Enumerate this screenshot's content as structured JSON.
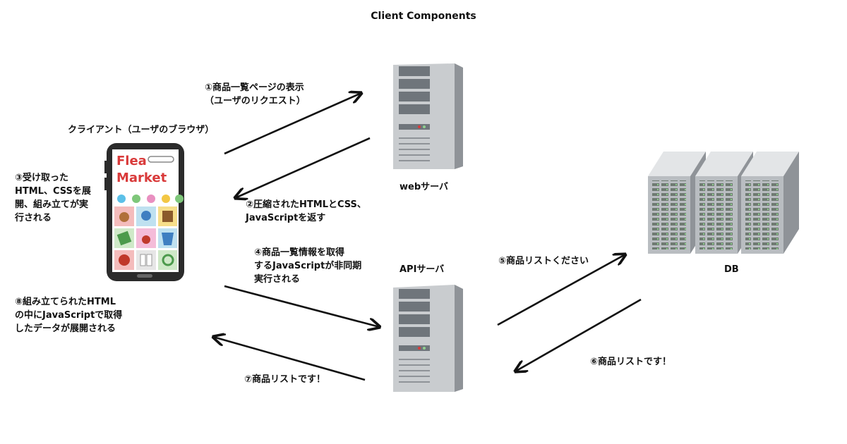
{
  "title": "Client Components",
  "client": {
    "label": "クライアント（ユーザのブラウザ）",
    "phone_logo_line1": "Flea",
    "phone_logo_line2": "Market"
  },
  "nodes": {
    "web_server": "webサーバ",
    "api_server": "APIサーバ",
    "db": "DB"
  },
  "steps": {
    "s1": "①商品一覧ページの表示\n（ユーザのリクエスト）",
    "s2": "②圧縮されたHTMLとCSS、\nJavaScriptを返す",
    "s3": "③受け取った\nHTML、CSSを展\n開、組み立てが実\n行される",
    "s4": "④商品一覧情報を取得\nするJavaScriptが非同期\n実行される",
    "s5": "⑤商品リストください",
    "s6": "⑥商品リストです！",
    "s7": "⑦商品リストです！",
    "s8": "⑧組み立てられたHTML\nの中にJavaScriptで取得\nしたデータが展開される"
  },
  "colors": {
    "arrow": "#111111",
    "server_body": "#c9cccf",
    "server_side": "#8f9398",
    "accent_red": "#d93a3a"
  }
}
